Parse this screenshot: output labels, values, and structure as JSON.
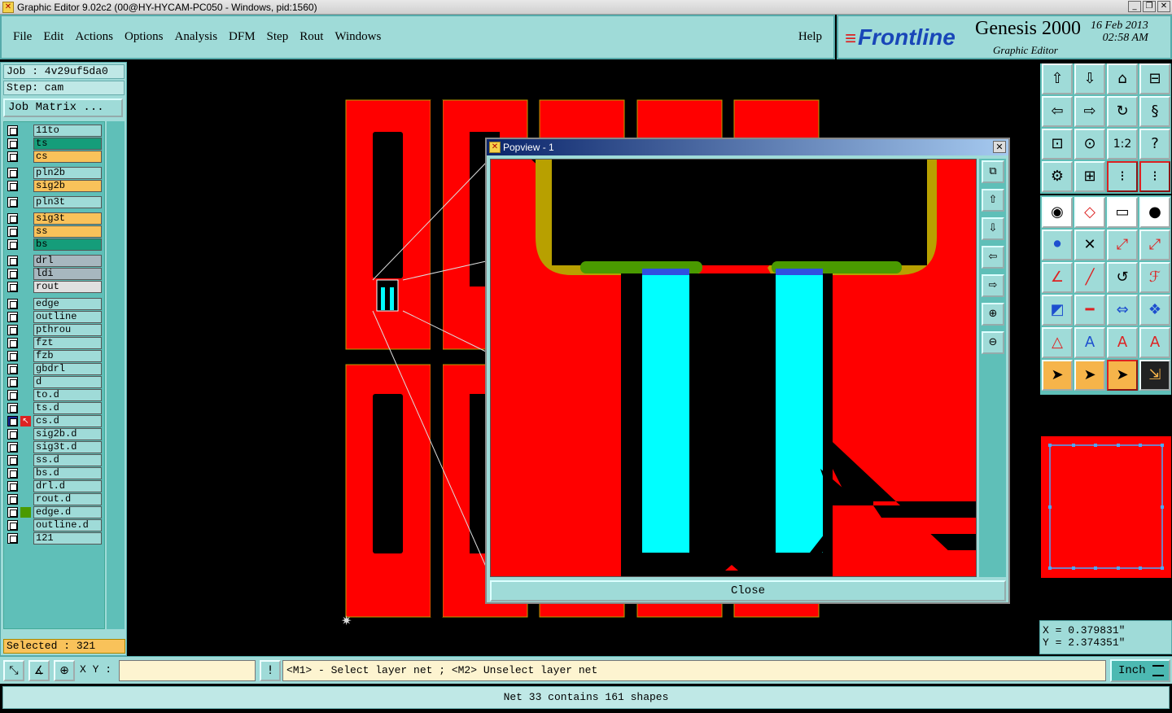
{
  "window": {
    "title": "Graphic Editor 9.02c2 (00@HY-HYCAM-PC050 - Windows, pid:1560)"
  },
  "menu": {
    "items": [
      "File",
      "Edit",
      "Actions",
      "Options",
      "Analysis",
      "DFM",
      "Step",
      "Rout",
      "Windows"
    ],
    "help": "Help"
  },
  "brand": {
    "logo": "Frontline",
    "product": "Genesis 2000",
    "subtitle": "Graphic Editor",
    "date": "16 Feb 2013",
    "time": "02:58 AM"
  },
  "job": {
    "job_label": "Job : 4v29uf5da0",
    "step_label": "Step: cam",
    "matrix_button": "Job Matrix ..."
  },
  "layers": [
    {
      "name": "11to",
      "color": "#9fdbd8"
    },
    {
      "name": "ts",
      "color": "#159d7a"
    },
    {
      "name": "cs",
      "color": "#f9c25a"
    },
    {
      "name": "pln2b",
      "color": "#9fdbd8"
    },
    {
      "name": "sig2b",
      "color": "#f9c25a"
    },
    {
      "name": "pln3t",
      "color": "#9fdbd8"
    },
    {
      "name": "sig3t",
      "color": "#f9c25a"
    },
    {
      "name": "ss",
      "color": "#f9c25a"
    },
    {
      "name": "bs",
      "color": "#159d7a"
    },
    {
      "name": "drl",
      "color": "#a7b7bf"
    },
    {
      "name": "ldi",
      "color": "#a7b7bf"
    },
    {
      "name": "rout",
      "color": "#e0e0e0"
    },
    {
      "name": "edge",
      "color": "#9fdbd8"
    },
    {
      "name": "outline",
      "color": "#9fdbd8"
    },
    {
      "name": "pthrou",
      "color": "#9fdbd8"
    },
    {
      "name": "fzt",
      "color": "#9fdbd8"
    },
    {
      "name": "fzb",
      "color": "#9fdbd8"
    },
    {
      "name": "gbdrl",
      "color": "#9fdbd8"
    },
    {
      "name": "d",
      "color": "#9fdbd8"
    },
    {
      "name": "to.d",
      "color": "#9fdbd8"
    },
    {
      "name": "ts.d",
      "color": "#9fdbd8"
    },
    {
      "name": "cs.d",
      "color": "#9fdbd8"
    },
    {
      "name": "sig2b.d",
      "color": "#9fdbd8"
    },
    {
      "name": "sig3t.d",
      "color": "#9fdbd8"
    },
    {
      "name": "ss.d",
      "color": "#9fdbd8"
    },
    {
      "name": "bs.d",
      "color": "#9fdbd8"
    },
    {
      "name": "drl.d",
      "color": "#9fdbd8"
    },
    {
      "name": "rout.d",
      "color": "#9fdbd8"
    },
    {
      "name": "edge.d",
      "color": "#9fdbd8"
    },
    {
      "name": "outline.d",
      "color": "#9fdbd8"
    },
    {
      "name": "121",
      "color": "#9fdbd8"
    }
  ],
  "selected": "Selected : 321",
  "popview": {
    "title": "Popview - 1",
    "close": "Close"
  },
  "coords": {
    "x": "X = 0.379831\"",
    "y": "Y = 2.374351\""
  },
  "bottom": {
    "xy_label": "X Y :",
    "xy_value": "",
    "prompt": "<M1> - Select layer net ; <M2> Unselect layer net",
    "units": "Inch"
  },
  "status": "Net 33 contains 161 shapes",
  "colors": {
    "board_red": "#ff0000",
    "pad_cyan": "#00ffff",
    "mask_green": "#4a9a00",
    "copper_olive": "#b8a000"
  }
}
